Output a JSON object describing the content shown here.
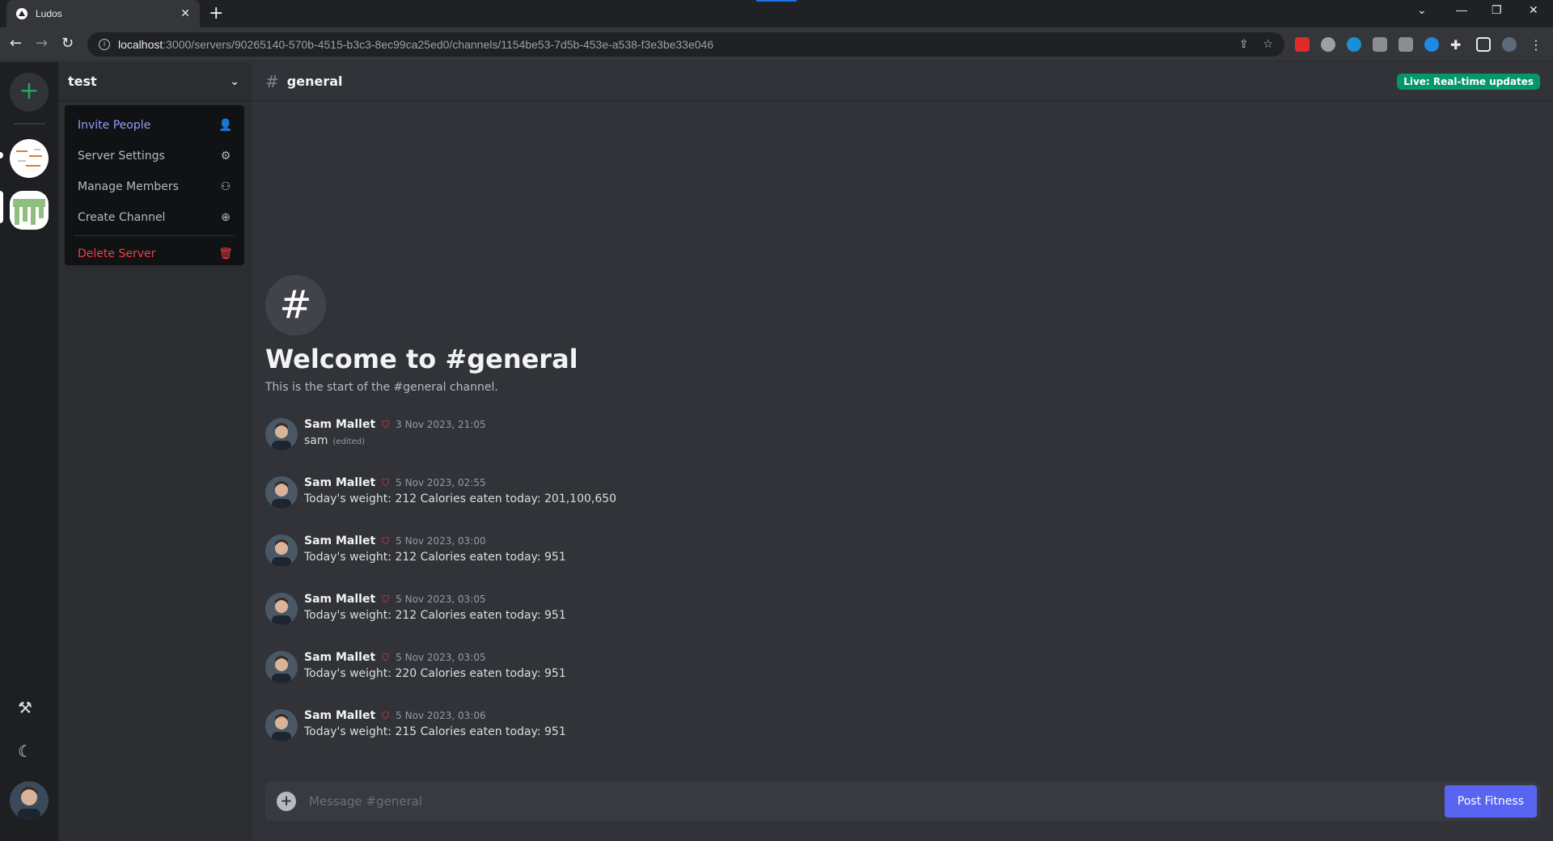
{
  "browser": {
    "tab_title": "Ludos",
    "url_host": "localhost",
    "url_path": ":3000/servers/90265140-570b-4515-b3c3-8ec99ca25ed0/channels/1154be53-7d5b-453e-a538-f3e3be33e046"
  },
  "rail": {
    "add_server_glyph": "+"
  },
  "server": {
    "name": "test",
    "menu": [
      {
        "label": "Invite People",
        "icon": "user-plus-icon"
      },
      {
        "label": "Server Settings",
        "icon": "gear-icon"
      },
      {
        "label": "Manage Members",
        "icon": "users-icon"
      },
      {
        "label": "Create Channel",
        "icon": "plus-circle-icon"
      },
      {
        "label": "Delete Server",
        "icon": "trash-icon"
      }
    ]
  },
  "channel": {
    "name": "general",
    "live_badge": "Live: Real-time updates",
    "welcome_title": "Welcome to #general",
    "welcome_sub": "This is the start of the #general channel."
  },
  "messages": [
    {
      "author": "Sam Mallet",
      "time": "3 Nov 2023, 21:05",
      "text": "sam",
      "edited": "(edited)"
    },
    {
      "author": "Sam Mallet",
      "time": "5 Nov 2023, 02:55",
      "text": "Today's weight: 212 Calories eaten today: 201,100,650"
    },
    {
      "author": "Sam Mallet",
      "time": "5 Nov 2023, 03:00",
      "text": "Today's weight: 212 Calories eaten today: 951"
    },
    {
      "author": "Sam Mallet",
      "time": "5 Nov 2023, 03:05",
      "text": "Today's weight: 212 Calories eaten today: 951"
    },
    {
      "author": "Sam Mallet",
      "time": "5 Nov 2023, 03:05",
      "text": "Today's weight: 220 Calories eaten today: 951"
    },
    {
      "author": "Sam Mallet",
      "time": "5 Nov 2023, 03:06",
      "text": "Today's weight: 215 Calories eaten today: 951"
    }
  ],
  "composer": {
    "placeholder": "Message #general",
    "post_label": "Post Fitness"
  },
  "colors": {
    "accent": "#5865f2",
    "live": "#059669",
    "danger": "#f23f43",
    "invite": "#949cf7"
  }
}
